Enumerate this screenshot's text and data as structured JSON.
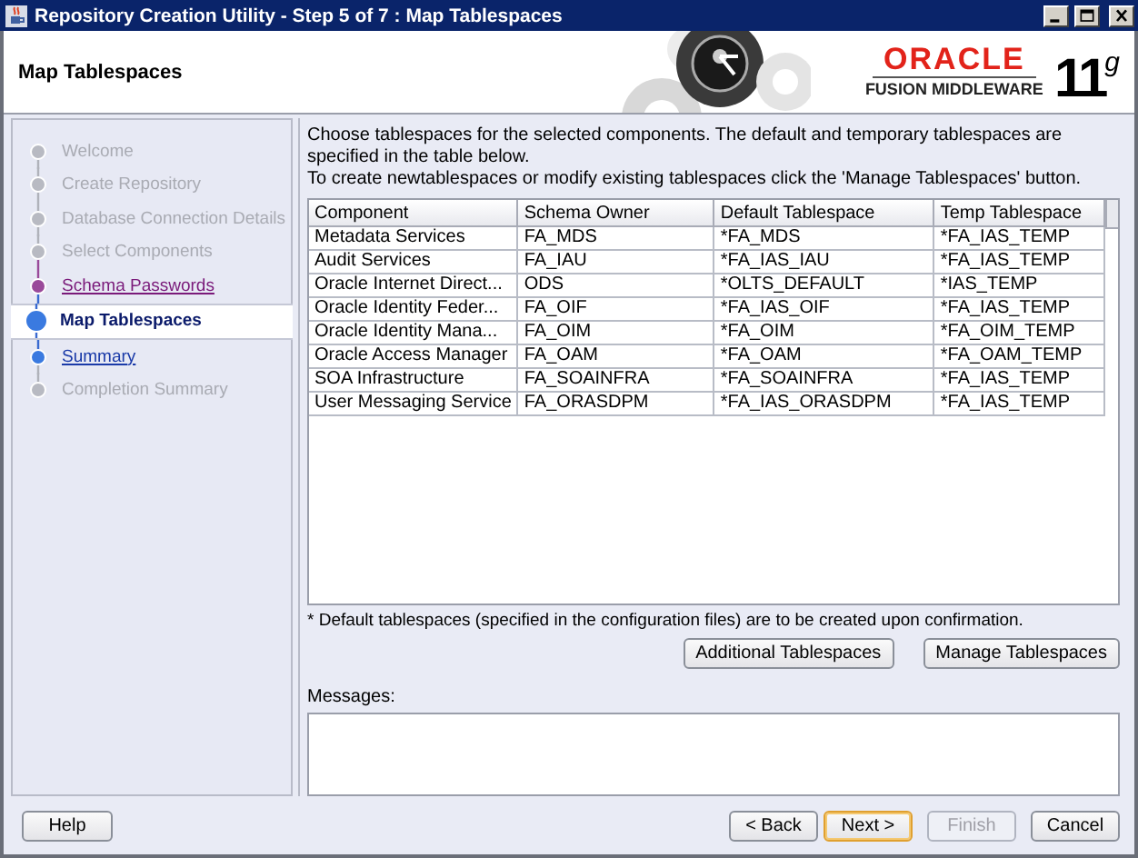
{
  "window": {
    "title": "Repository Creation Utility - Step 5 of 7 : Map Tablespaces"
  },
  "header": {
    "title": "Map Tablespaces",
    "brand": "ORACLE",
    "product": "FUSION MIDDLEWARE",
    "version": "11$^{g}$"
  },
  "steps": [
    {
      "label": "Welcome",
      "selected": false,
      "disabled": true,
      "visited": false
    },
    {
      "label": "Create Repository",
      "selected": false,
      "disabled": true,
      "visited": false
    },
    {
      "label": "Database Connection Details",
      "selected": false,
      "disabled": true,
      "visited": false
    },
    {
      "label": "Select Components",
      "selected": false,
      "disabled": true,
      "visited": false
    },
    {
      "label": "Schema Passwords",
      "selected": false,
      "disabled": false,
      "visited": true
    },
    {
      "label": "Map Tablespaces",
      "selected": true,
      "disabled": false,
      "visited": false
    },
    {
      "label": "Summary",
      "selected": false,
      "disabled": false,
      "visited": false
    },
    {
      "label": "Completion Summary",
      "selected": false,
      "disabled": true,
      "visited": false
    }
  ],
  "intro": [
    "Choose tablespaces for the selected components. The default and temporary tablespaces are specified in the table below.",
    "To create newtablespaces or modify existing tablespaces click the 'Manage Tablespaces' button."
  ],
  "table": {
    "columns": [
      "Component",
      "Schema Owner",
      "Default Tablespace",
      "Temp Tablespace"
    ],
    "rows": [
      [
        "Metadata Services",
        "FA_MDS",
        "*FA_MDS",
        "*FA_IAS_TEMP"
      ],
      [
        "Audit Services",
        "FA_IAU",
        "*FA_IAS_IAU",
        "*FA_IAS_TEMP"
      ],
      [
        "Oracle Internet Direct...",
        "ODS",
        "*OLTS_DEFAULT",
        "*IAS_TEMP"
      ],
      [
        "Oracle Identity Feder...",
        "FA_OIF",
        "*FA_IAS_OIF",
        "*FA_IAS_TEMP"
      ],
      [
        "Oracle Identity Mana...",
        "FA_OIM",
        "*FA_OIM",
        "*FA_OIM_TEMP"
      ],
      [
        "Oracle Access Manager",
        "FA_OAM",
        "*FA_OAM",
        "*FA_OAM_TEMP"
      ],
      [
        "SOA Infrastructure",
        "FA_SOAINFRA",
        "*FA_SOAINFRA",
        "*FA_IAS_TEMP"
      ],
      [
        "User Messaging Service",
        "FA_ORASDPM",
        "*FA_IAS_ORASDPM",
        "*FA_IAS_TEMP"
      ]
    ]
  },
  "footnote": "* Default tablespaces (specified in the configuration files) are to be created upon confirmation.",
  "table_buttons": [
    {
      "label": "Additional Tablespaces"
    },
    {
      "label": "Manage Tablespaces"
    }
  ],
  "messages": {
    "label": "Messages:"
  },
  "help_button": {
    "label": "Help"
  },
  "nav_buttons": [
    {
      "label": "< Back",
      "disabled": false,
      "default": false
    },
    {
      "label": "Next >",
      "disabled": false,
      "default": true
    },
    {
      "label": "Finish",
      "disabled": true,
      "default": false
    },
    {
      "label": "Cancel",
      "disabled": false,
      "default": false
    }
  ]
}
